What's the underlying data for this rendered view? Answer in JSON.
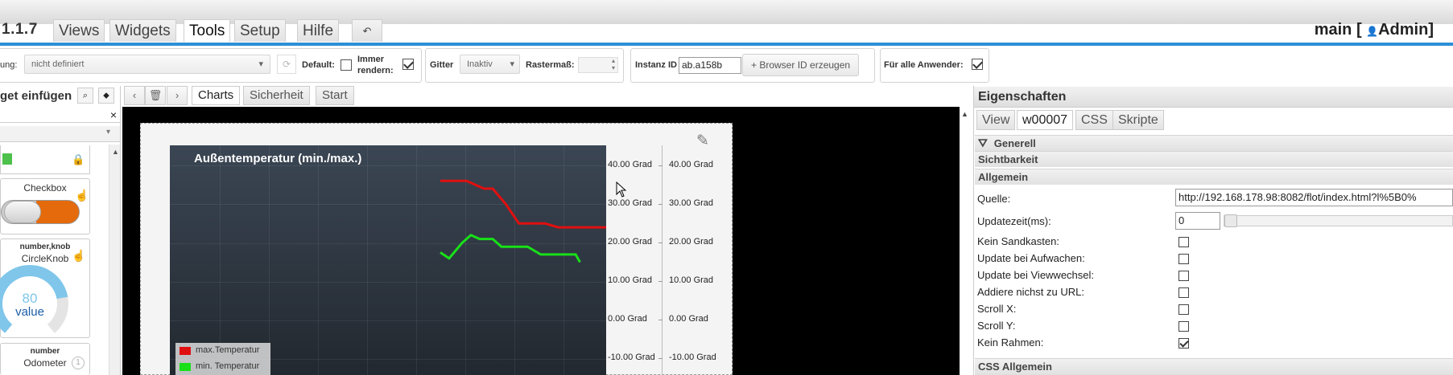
{
  "app": {
    "version": "1.1.7",
    "user": "main [ ",
    "user_role": "Admin]"
  },
  "menu_tabs": [
    "Views",
    "Widgets",
    "Tools",
    "Setup",
    "Hilfe"
  ],
  "toolbar": {
    "resolution_label": "ung:",
    "resolution_value": "nicht definiert",
    "default_label": "Default:",
    "always_render_label_1": "Immer",
    "always_render_label_2": "rendern:",
    "grid_label": "Gitter",
    "grid_value": "Inaktiv",
    "raster_label": "Rastermaß:",
    "instance_label": "Instanz ID",
    "instance_value": "ab.a158b",
    "browser_id_button": "Browser ID erzeugen",
    "all_users_label": "Für alle Anwender:"
  },
  "left_panel": {
    "title": "get einfügen",
    "widgets": [
      {
        "name": "Checkbox"
      },
      {
        "name": "CircleKnob",
        "tags": "number,knob",
        "knob_value": "80",
        "knob_text": "value"
      },
      {
        "name": "Odometer",
        "tags": "number"
      }
    ]
  },
  "view_tabs": [
    "Charts",
    "Sicherheit",
    "Start"
  ],
  "chart_data": {
    "type": "line",
    "title": "Außentemperatur (min./max.)",
    "yticks": [
      "40.00 Grad",
      "30.00 Grad",
      "20.00 Grad",
      "10.00 Grad",
      "0.00 Grad",
      "-10.00 Grad"
    ],
    "ytick_values": [
      40,
      30,
      20,
      10,
      0,
      -10
    ],
    "series": [
      {
        "name": "max.Temperatur",
        "color": "#e01010",
        "points": [
          [
            0.62,
            36
          ],
          [
            0.68,
            36
          ],
          [
            0.72,
            34
          ],
          [
            0.74,
            34
          ],
          [
            0.77,
            30
          ],
          [
            0.8,
            25
          ],
          [
            0.86,
            25
          ],
          [
            0.89,
            24
          ],
          [
            1.0,
            24
          ]
        ]
      },
      {
        "name": "min. Temperatur",
        "color": "#18e018",
        "points": [
          [
            0.62,
            17.5
          ],
          [
            0.64,
            16
          ],
          [
            0.67,
            20
          ],
          [
            0.69,
            22
          ],
          [
            0.71,
            21
          ],
          [
            0.74,
            21
          ],
          [
            0.76,
            19
          ],
          [
            0.82,
            19
          ],
          [
            0.85,
            17
          ],
          [
            0.93,
            17
          ],
          [
            0.94,
            15
          ]
        ]
      }
    ],
    "ylim": [
      -15,
      45
    ]
  },
  "properties": {
    "title": "Eigenschaften",
    "tabs": [
      "View",
      "w00007",
      "CSS",
      "Skripte"
    ],
    "filter_label": "Generell",
    "sections": [
      "Sichtbarkeit",
      "Allgemein"
    ],
    "source_label": "Quelle:",
    "source_value": "http://192.168.178.98:8082/flot/index.html?l%5B0%",
    "update_label": "Updatezeit(ms):",
    "update_value": "0",
    "checkbox_rows": [
      {
        "label": "Kein Sandkasten:",
        "checked": false
      },
      {
        "label": "Update bei Aufwachen:",
        "checked": false
      },
      {
        "label": "Update bei Viewwechsel:",
        "checked": false
      },
      {
        "label": "Addiere nichst zu URL:",
        "checked": false
      },
      {
        "label": "Scroll X:",
        "checked": false
      },
      {
        "label": "Scroll Y:",
        "checked": false
      },
      {
        "label": "Kein Rahmen:",
        "checked": true
      }
    ],
    "css_section": "CSS Allgemein"
  }
}
